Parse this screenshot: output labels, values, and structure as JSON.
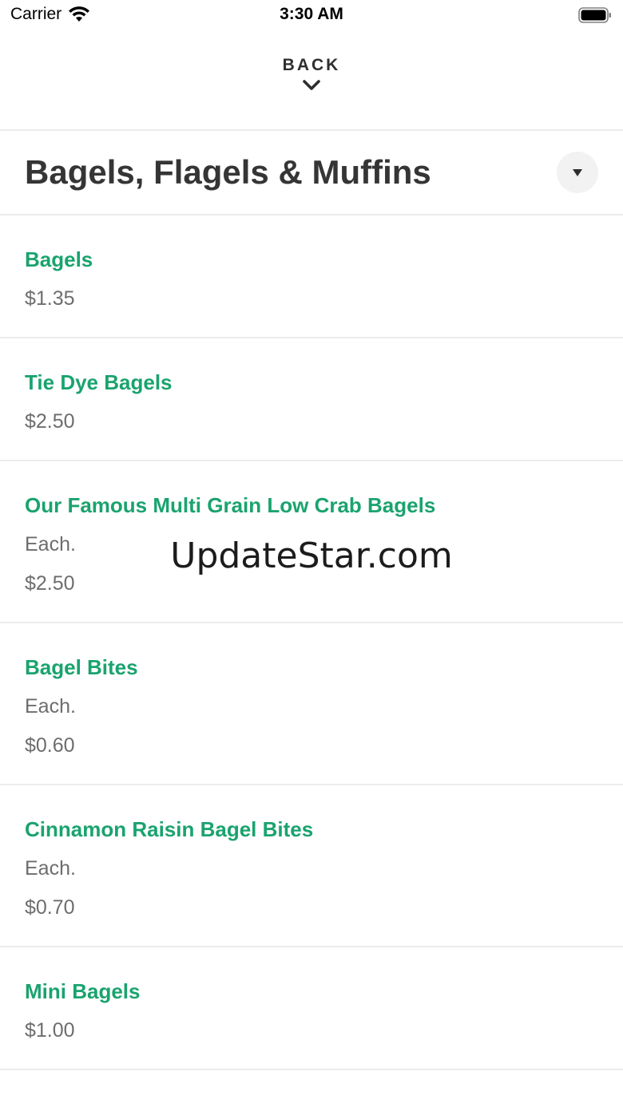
{
  "status_bar": {
    "carrier": "Carrier",
    "time": "3:30 AM"
  },
  "nav": {
    "back_label": "BACK"
  },
  "category": {
    "title": "Bagels, Flagels & Muffins"
  },
  "items": [
    {
      "name": "Bagels",
      "description": "",
      "price": "$1.35"
    },
    {
      "name": "Tie Dye Bagels",
      "description": "",
      "price": "$2.50"
    },
    {
      "name": "Our Famous Multi Grain Low Crab Bagels",
      "description": "Each.",
      "price": "$2.50"
    },
    {
      "name": "Bagel Bites",
      "description": "Each.",
      "price": "$0.60"
    },
    {
      "name": "Cinnamon Raisin Bagel Bites",
      "description": "Each.",
      "price": "$0.70"
    },
    {
      "name": "Mini Bagels",
      "description": "",
      "price": "$1.00"
    }
  ],
  "watermark": "UpdateStar.com",
  "colors": {
    "accent": "#1aa36f",
    "text_dark": "#353535",
    "text_muted": "#6d6d6d",
    "divider": "#ececec"
  }
}
